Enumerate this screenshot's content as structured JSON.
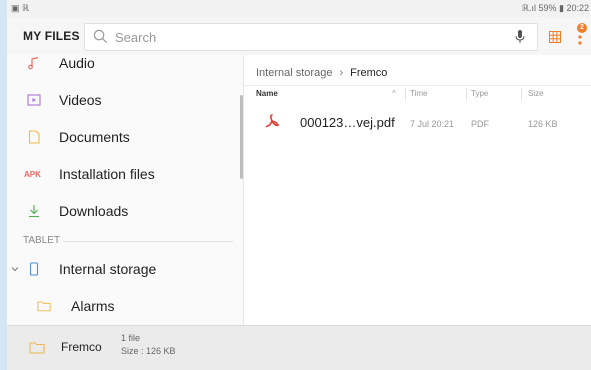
{
  "status_bar": {
    "left": "▣ ℝ",
    "right": "ℝ.ıl 59% ▮ 20:22"
  },
  "app_bar": {
    "title": "MY FILES",
    "search_placeholder": "Search",
    "notification_count": "2"
  },
  "sidebar": {
    "items": [
      {
        "label": "Audio",
        "icon": "music-note-icon"
      },
      {
        "label": "Videos",
        "icon": "video-icon"
      },
      {
        "label": "Documents",
        "icon": "document-icon"
      },
      {
        "label": "Installation files",
        "icon": "apk-icon",
        "icon_text": "APK"
      },
      {
        "label": "Downloads",
        "icon": "download-icon"
      }
    ],
    "section_label": "TABLET",
    "tablet_items": [
      {
        "label": "Internal storage",
        "icon": "phone-icon"
      },
      {
        "label": "Alarms",
        "icon": "folder-icon"
      }
    ]
  },
  "main": {
    "breadcrumb": {
      "root": "Internal storage",
      "separator": "›",
      "current": "Fremco"
    },
    "columns": {
      "name": "Name",
      "sort_indicator": "^",
      "time": "Time",
      "type": "Type",
      "size": "Size"
    },
    "files": [
      {
        "name": "000123…vej.pdf",
        "time": "7 Jul 20:21",
        "type": "PDF",
        "size": "126 KB"
      }
    ]
  },
  "bottom_bar": {
    "folder_name": "Fremco",
    "file_count": "1 file",
    "size": "Size : 126 KB"
  },
  "colors": {
    "pdf_red": "#e53935",
    "folder_yellow": "#f2b84b",
    "accent_orange": "#f07d2a"
  }
}
